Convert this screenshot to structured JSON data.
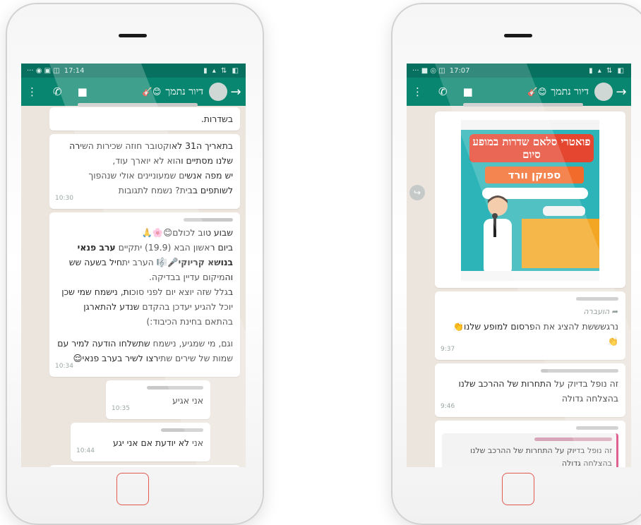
{
  "left_phone": {
    "status_time": "17:14",
    "status_icons_left": "⚡ ✉ ▯",
    "contact_name": "דיור נתמך",
    "contact_emoji": "😊🎸",
    "messages": [
      {
        "text_lines": [
          "בשדרות."
        ],
        "time": ""
      },
      {
        "text_lines": [
          "בתאריך ה31 לאוקטובר חוזה שכירות השירה שלנו מסתיים והוא לא יוארך עוד,",
          "יש מפה אנשים שמעוניינים אולי שנהפוך לשותפים בבית? נשמח לתגובות"
        ],
        "time": "10:30"
      },
      {
        "line1": "שבוע טוב לכולם😊🌸🙏",
        "line2_a": "ביום ראשון הבא (19.9) יתקיים ",
        "line2_bold": "ערב פנאי בנושא קריוקי",
        "line2_b": "🎤🎼 הערב יתחיל בשעה שש והמיקום עדיין בבדיקה.",
        "line3": "בגלל שזה יוצא יום לפני סוכות, נישמח שמי שכן יוכל להגיע יעדכן בהקדם שנדע להתארגן בהתאם בחינת הכיבוד:)",
        "line4": "וגם, מי שמגיע, נישמח שתשלחו הודעה למיר עם שמות של שירים שתירצו לשיר בערב פנאי😌",
        "time": "10:34"
      },
      {
        "text": "אני אגיע",
        "time": "10:35"
      },
      {
        "text": "אני לא יודעת אם אני יגע",
        "time": "10:44"
      }
    ]
  },
  "right_phone": {
    "status_time": "17:07",
    "contact_name": "דיור נתמך",
    "contact_emoji": "😊🎸",
    "poster": {
      "title": "פואטרי סלאם שדרות במופע סיום",
      "subtitle": "ספוקן וורד"
    },
    "messages": [
      {
        "forwarded_label": "הועברה",
        "text": "נרגשששת להציג את הפרסום למופע שלנו👏",
        "emoji_line": "👏",
        "time": "9:37"
      },
      {
        "text": "זה נופל בדיוק על התחרות של ההרכב שלנו בהצלחה גדולה",
        "time": "9:46"
      },
      {
        "quote": "זה נופל בדיוק על התחרות של ההרכב שלנו בהצלחה גדולה"
      }
    ]
  }
}
